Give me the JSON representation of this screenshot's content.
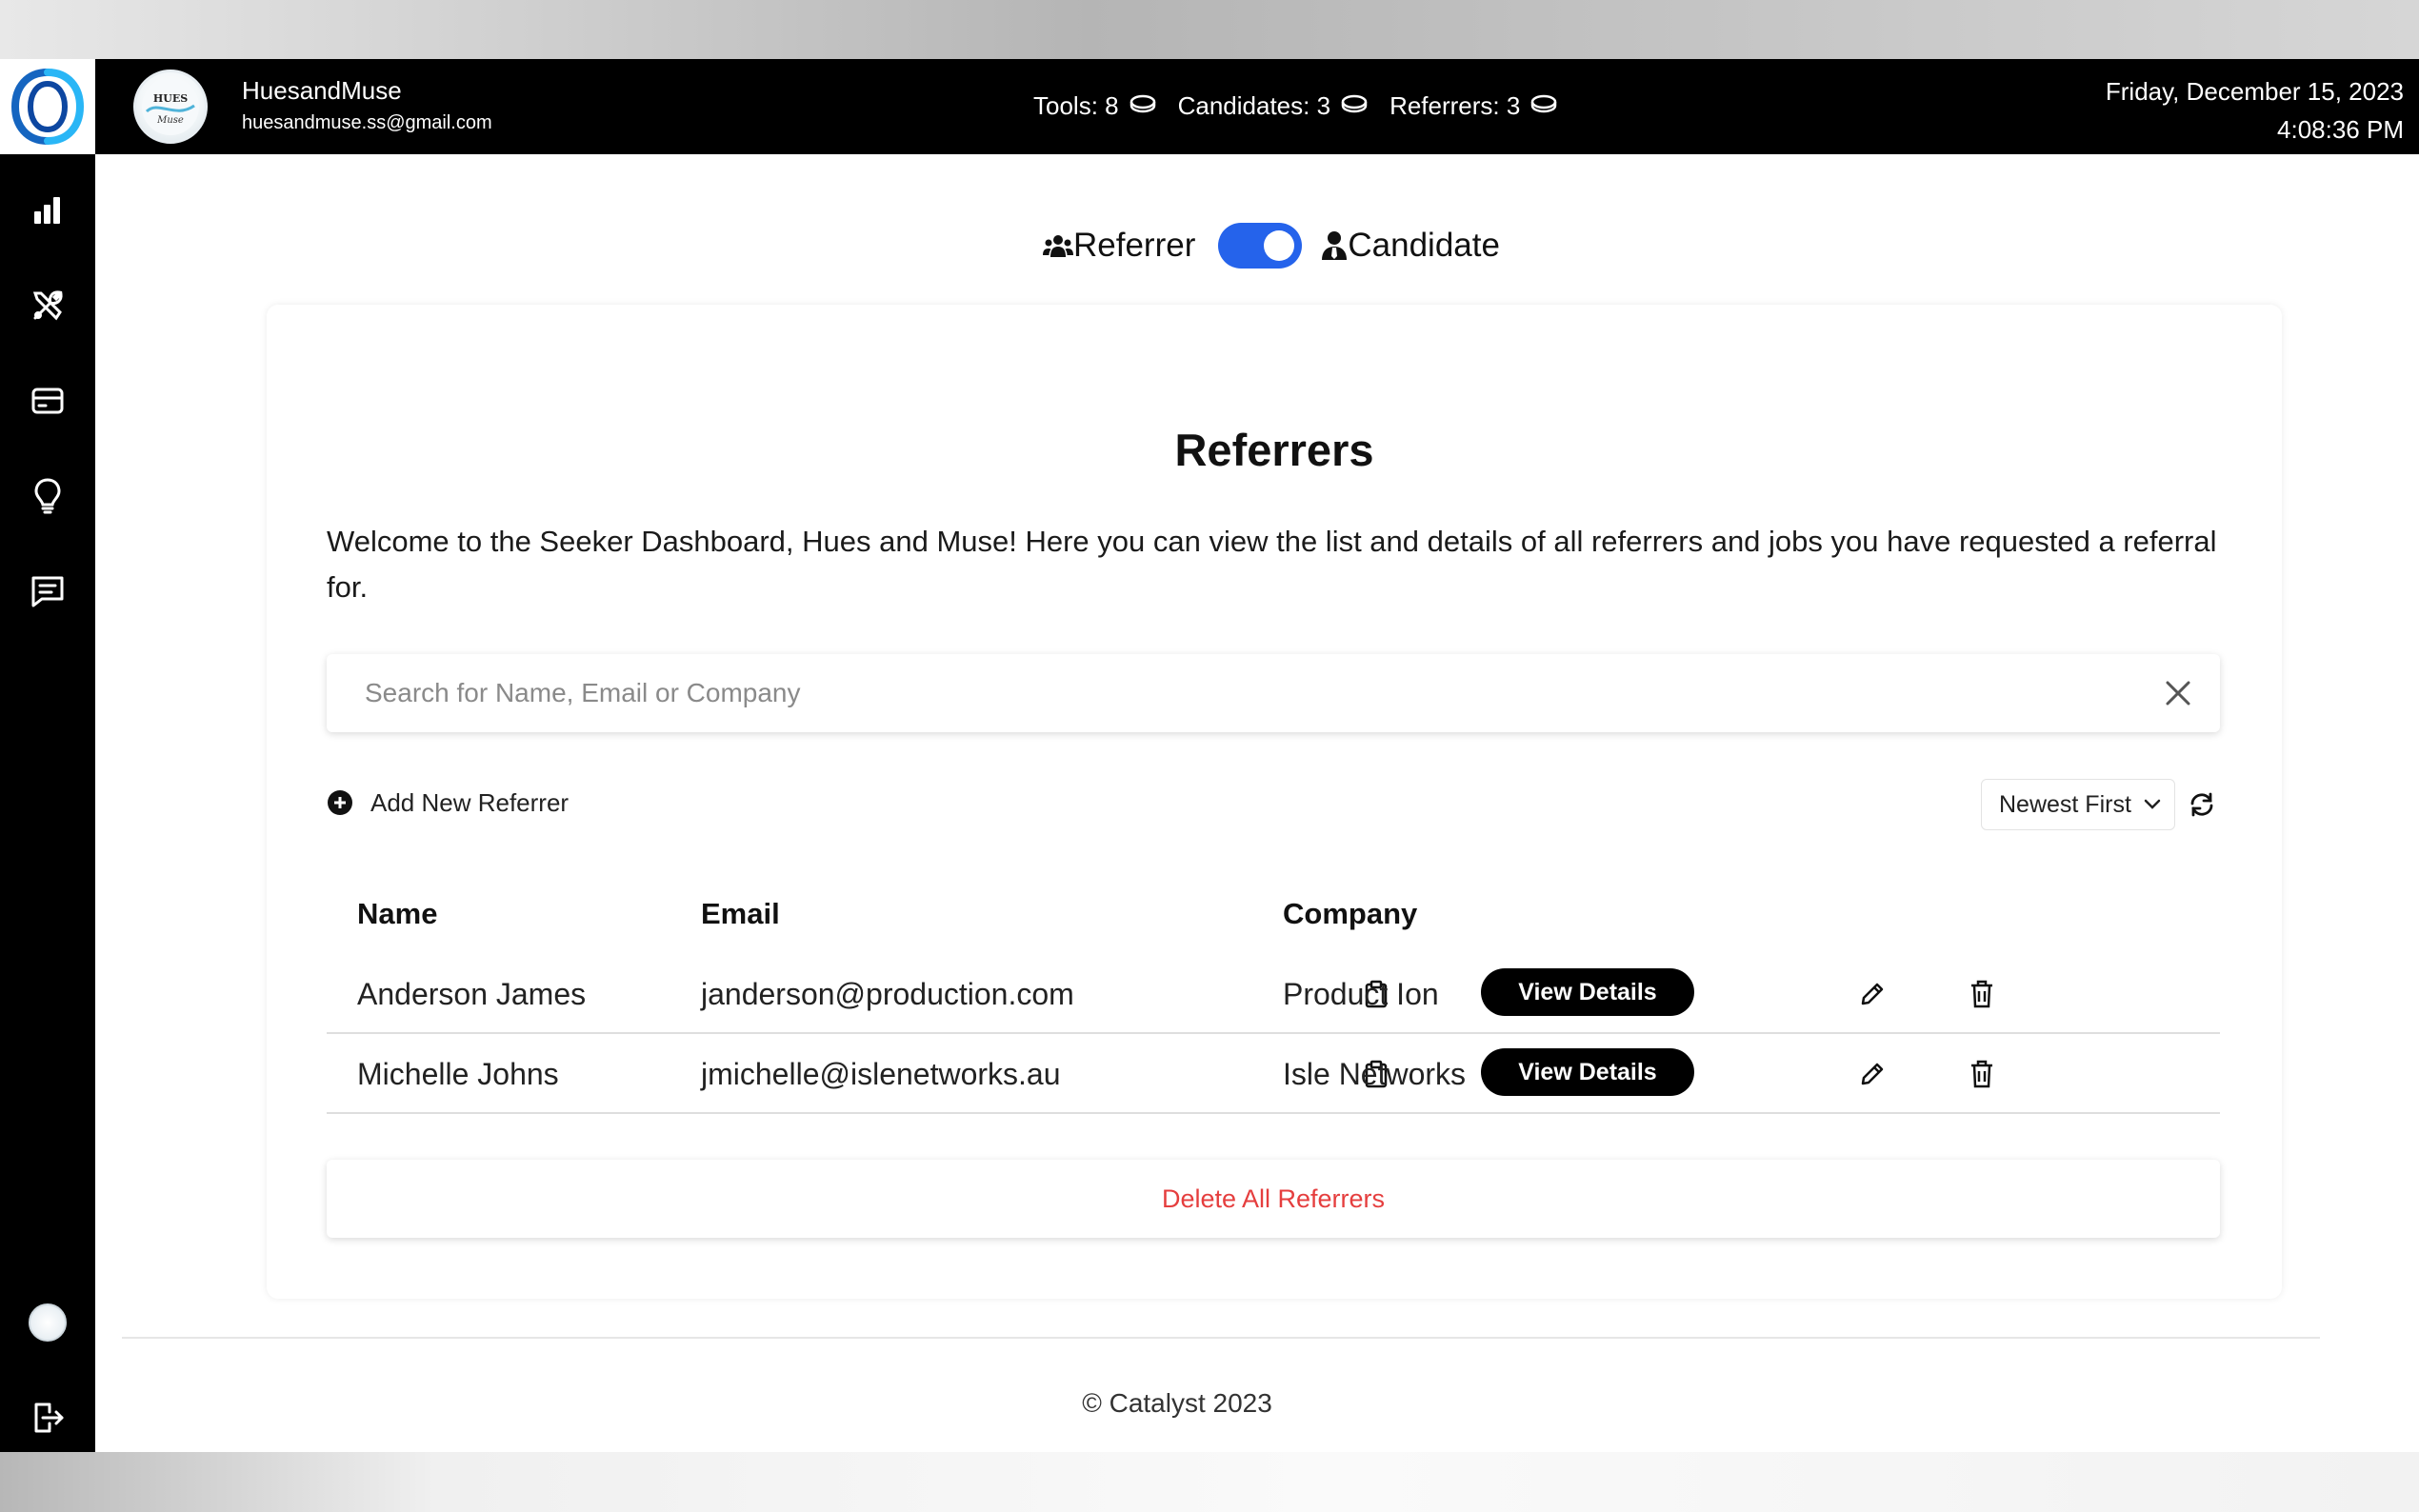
{
  "user": {
    "name": "HuesandMuse",
    "email": "huesandmuse.ss@gmail.com",
    "avatar_text_top": "HUES",
    "avatar_text_bottom": "Muse"
  },
  "counters": [
    {
      "label": "Tools: 8"
    },
    {
      "label": "Candidates: 3"
    },
    {
      "label": "Referrers: 3"
    }
  ],
  "datetime": {
    "date": "Friday, December 15, 2023",
    "time": "4:08:36 PM"
  },
  "sidebar": {
    "items": [
      {
        "icon": "bar-chart-icon"
      },
      {
        "icon": "tools-icon"
      },
      {
        "icon": "credit-card-icon"
      },
      {
        "icon": "lightbulb-icon"
      },
      {
        "icon": "message-icon"
      }
    ],
    "bottom": [
      {
        "icon": "avatar"
      },
      {
        "icon": "logout-icon"
      }
    ]
  },
  "mode_toggle": {
    "left_label": "Referrer",
    "right_label": "Candidate",
    "state": "on"
  },
  "page": {
    "title": "Referrers",
    "description": "Welcome to the Seeker Dashboard, Hues and Muse! Here you can view the list and details of all referrers and jobs you have requested a referral for."
  },
  "search": {
    "placeholder": "Search for Name, Email or Company",
    "value": ""
  },
  "actions": {
    "add_new_label": "Add New Referrer",
    "sort_selected": "Newest First",
    "view_details_label": "View Details",
    "delete_all_label": "Delete All Referrers"
  },
  "table": {
    "columns": [
      "Name",
      "Email",
      "Company"
    ],
    "rows": [
      {
        "name": "Anderson James",
        "email": "janderson@production.com",
        "company": "Product Ion"
      },
      {
        "name": "Michelle Johns",
        "email": "jmichelle@islenetworks.au",
        "company": "Isle Networks"
      }
    ]
  },
  "footer": {
    "text": "© Catalyst 2023"
  },
  "colors": {
    "accent": "#2563eb",
    "danger": "#e53e3e",
    "sidebar": "#000000",
    "logo": "#1a73c8"
  }
}
